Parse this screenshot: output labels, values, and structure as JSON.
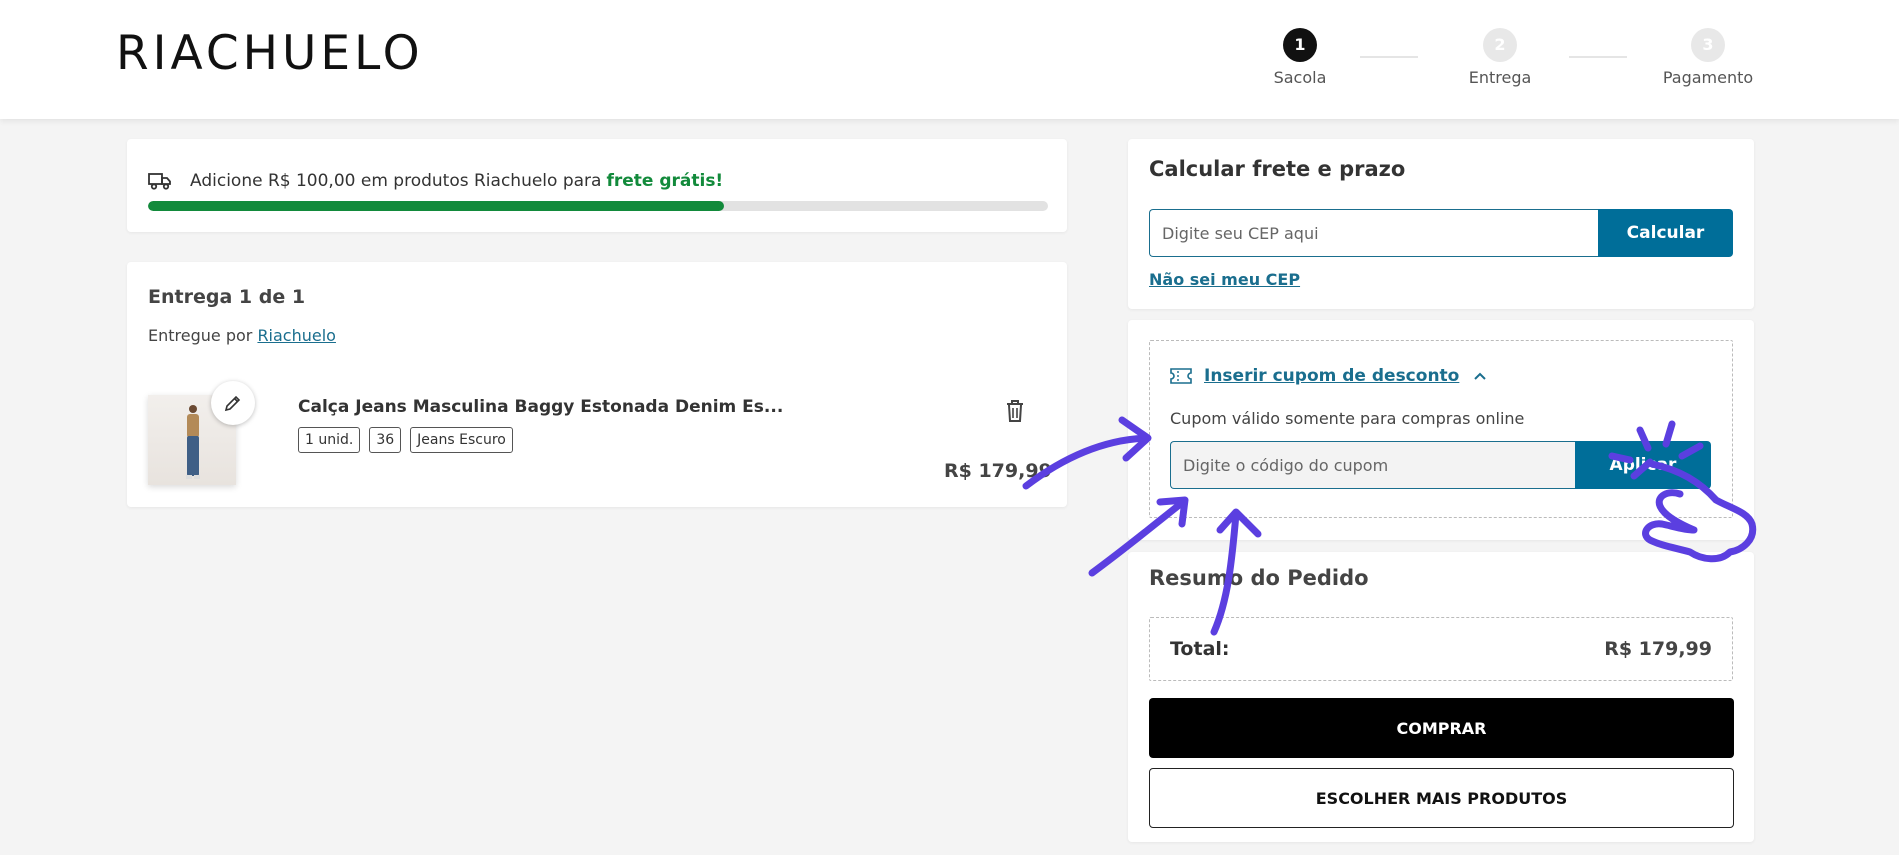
{
  "header": {
    "logo": "RIACHUELO",
    "steps": [
      {
        "number": "1",
        "label": "Sacola"
      },
      {
        "number": "2",
        "label": "Entrega"
      },
      {
        "number": "3",
        "label": "Pagamento"
      }
    ]
  },
  "shipping_banner": {
    "message": "Adicione R$ 100,00 em produtos Riachuelo para",
    "highlight": "frete grátis!",
    "progress_percent": 64,
    "progress_color": "#128a3b"
  },
  "delivery": {
    "title": "Entrega 1 de 1",
    "delivered_by_label": "Entregue por",
    "seller": "Riachuelo",
    "product": {
      "name": "Calça Jeans Masculina Baggy Estonada Denim Es...",
      "chips": [
        "1 unid.",
        "36",
        "Jeans Escuro"
      ],
      "price": "R$ 179,99"
    }
  },
  "frete": {
    "title": "Calcular frete e prazo",
    "cep_placeholder": "Digite seu CEP aqui",
    "calc_label": "Calcular",
    "nao_sei_label": "Não sei meu CEP"
  },
  "cupom": {
    "toggle_label": "Inserir cupom de desconto",
    "note": "Cupom válido somente para compras online",
    "input_placeholder": "Digite o código do cupom",
    "apply_label": "Aplicar"
  },
  "resumo": {
    "title": "Resumo do Pedido",
    "total_label": "Total:",
    "total_value": "R$ 179,99",
    "comprar_label": "COMPRAR",
    "mais_label": "ESCOLHER MAIS PRODUTOS"
  },
  "colors": {
    "brand_blue": "#006e99",
    "link_blue": "#1a6e8e",
    "green": "#128a3b",
    "annotation": "#5b3fe0"
  }
}
